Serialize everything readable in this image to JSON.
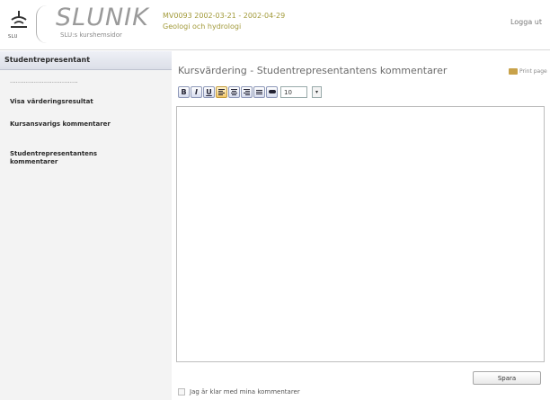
{
  "header": {
    "logo_title": "SLUNIK",
    "logo_subtitle": "SLU:s kurshemsidor",
    "logo_mark": "SLU",
    "course_line": "MV0093   2002-03-21 - 2002-04-29",
    "course_name": "Geologi och hydrologi",
    "logout_label": "Logga ut"
  },
  "sidebar": {
    "heading": "Studentrepresentant",
    "dots": "..................................",
    "items": [
      {
        "label": "Visa värderingsresultat"
      },
      {
        "label": "Kursansvarigs kommentarer"
      },
      {
        "label": "Studentrepresentantens kommentarer"
      }
    ]
  },
  "main": {
    "title": "Kursvärdering - Studentrepresentantens kommentarer",
    "print_label": "Print page",
    "toolbar": {
      "bold": "B",
      "italic": "I",
      "underline": "U",
      "font_size": "10",
      "dropdown": "▾"
    },
    "editor_value": "",
    "save_label": "Spara",
    "done_label": "Jag är klar med mina kommentarer"
  }
}
